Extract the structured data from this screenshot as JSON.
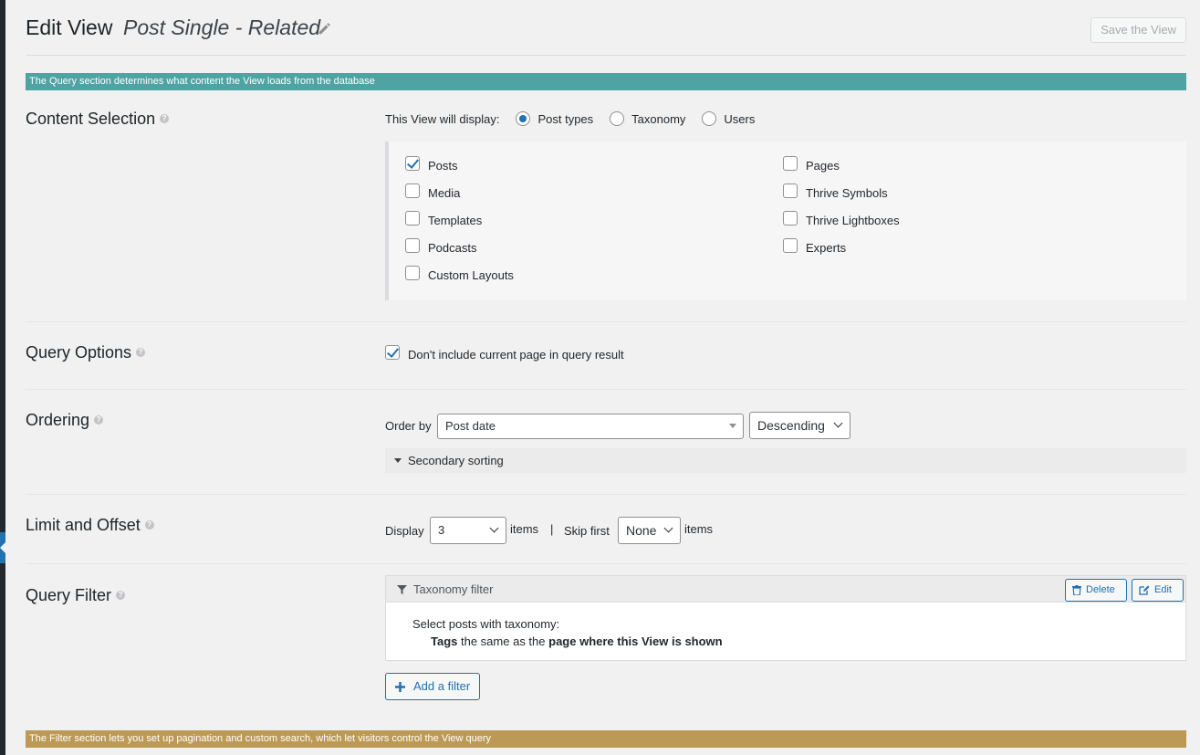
{
  "header": {
    "title": "Edit View",
    "view_name": "Post Single - Related",
    "save_label": "Save the View"
  },
  "banners": {
    "query": "The Query section determines what content the View loads from the database",
    "filter": "The Filter section lets you set up pagination and custom search, which let visitors control the View query"
  },
  "content_selection": {
    "title": "Content Selection",
    "display_label": "This View will display:",
    "options": [
      {
        "label": "Post types",
        "checked": true
      },
      {
        "label": "Taxonomy",
        "checked": false
      },
      {
        "label": "Users",
        "checked": false
      }
    ],
    "post_types_left": [
      {
        "label": "Posts",
        "checked": true
      },
      {
        "label": "Media",
        "checked": false
      },
      {
        "label": "Templates",
        "checked": false
      },
      {
        "label": "Podcasts",
        "checked": false
      },
      {
        "label": "Custom Layouts",
        "checked": false
      }
    ],
    "post_types_right": [
      {
        "label": "Pages",
        "checked": false
      },
      {
        "label": "Thrive Symbols",
        "checked": false
      },
      {
        "label": "Thrive Lightboxes",
        "checked": false
      },
      {
        "label": "Experts",
        "checked": false
      }
    ]
  },
  "query_options": {
    "title": "Query Options",
    "exclude_current_label": "Don't include current page in query result",
    "exclude_current_checked": true
  },
  "ordering": {
    "title": "Ordering",
    "order_by_label": "Order by",
    "order_by_value": "Post date",
    "direction_value": "Descending",
    "secondary_label": "Secondary sorting"
  },
  "limit_offset": {
    "title": "Limit and Offset",
    "display_label": "Display",
    "display_value": "3",
    "items_label": "items",
    "separator": "|",
    "skip_label": "Skip first",
    "skip_value": "None",
    "items_label_2": "items"
  },
  "query_filter": {
    "title": "Query Filter",
    "filter_name": "Taxonomy filter",
    "delete_label": "Delete",
    "edit_label": "Edit",
    "line1": "Select posts with taxonomy:",
    "line2_bold1": "Tags",
    "line2_mid": " the same as the ",
    "line2_bold2": "page where this View is shown",
    "add_label": "Add a filter"
  },
  "help_glyph": "?",
  "icons": {
    "pencil": "pencil-icon",
    "help": "help-icon",
    "funnel": "filter-icon",
    "trash": "trash-icon",
    "edit": "edit-icon",
    "plus": "plus-icon"
  }
}
